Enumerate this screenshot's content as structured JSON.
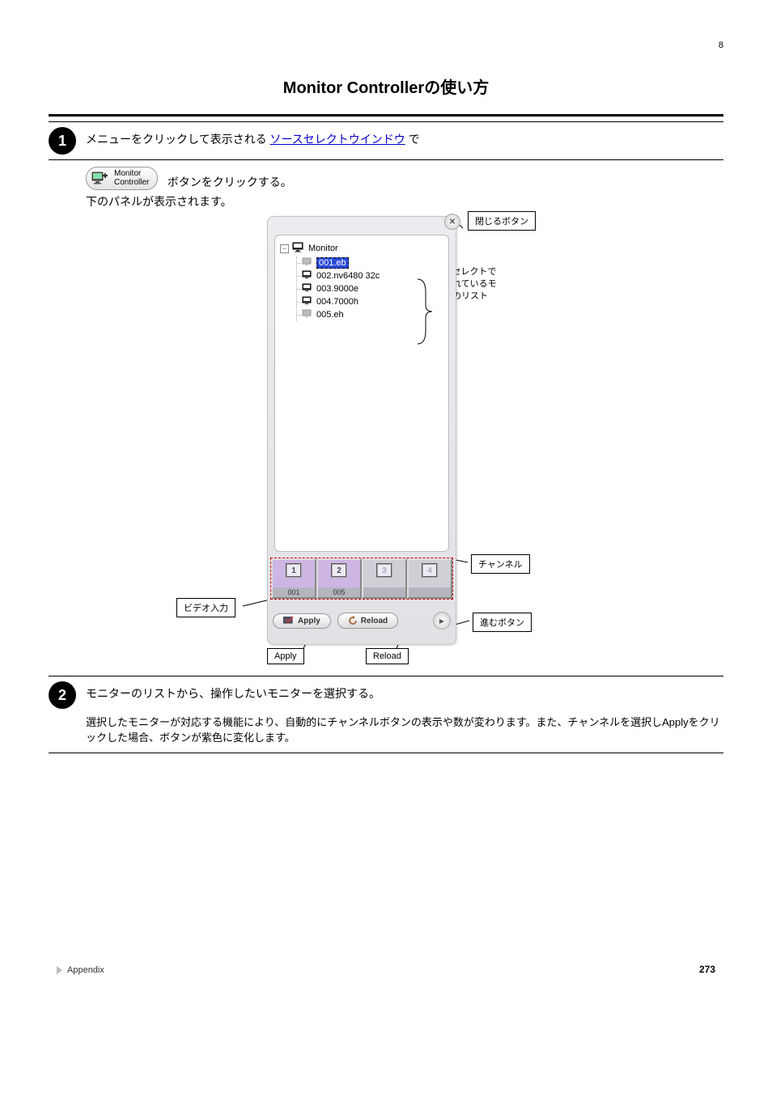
{
  "page_header_num": "8",
  "section_title": "Monitor Controllerの使い方",
  "step1": {
    "num": "1",
    "text_before_link": "メニューをクリックして表示される ",
    "link_text": "ソースセレクトウインドウ",
    "text_after_link": " で",
    "line2": "ボタンをクリックする。",
    "followup": "下のパネルが表示されます。"
  },
  "mc_button": {
    "label_line1": "Monitor",
    "label_line2": "Controller"
  },
  "controller": {
    "close_callout": "閉じるボタン",
    "tree_root": "Monitor",
    "tree_items": [
      {
        "label": "001.eb",
        "selected": true,
        "dim": true
      },
      {
        "label": "002.nv6480 32c",
        "selected": false,
        "dim": false
      },
      {
        "label": "003.9000e",
        "selected": false,
        "dim": false
      },
      {
        "label": "004.7000h",
        "selected": false,
        "dim": false
      },
      {
        "label": "005.eh",
        "selected": false,
        "dim": true
      }
    ],
    "list_side_note": "ソースセレクトで管理されているモニターのリスト",
    "channels": [
      {
        "index": "1",
        "label": "001",
        "active": true
      },
      {
        "index": "2",
        "label": "005",
        "active": true
      },
      {
        "index": "3",
        "label": "",
        "active": false
      },
      {
        "index": "4",
        "label": "",
        "active": false
      }
    ],
    "channel_callout": "チャンネル",
    "video_in_callout": "ビデオ入力",
    "forward_callout": "進むボタン",
    "apply_label": "Apply",
    "apply_callout": "Apply",
    "reload_label": "Reload",
    "reload_callout": "Reload"
  },
  "step2": {
    "num": "2",
    "text": "モニターのリストから、操作したいモニターを選択する。",
    "para_after": "選択したモニターが対応する機能により、自動的にチャンネルボタンの表示や数が変わります。また、チャンネルを選択しApplyをクリックした場合、ボタンが紫色に変化します。"
  },
  "footer": {
    "crumb": "Appendix",
    "page": "273"
  }
}
